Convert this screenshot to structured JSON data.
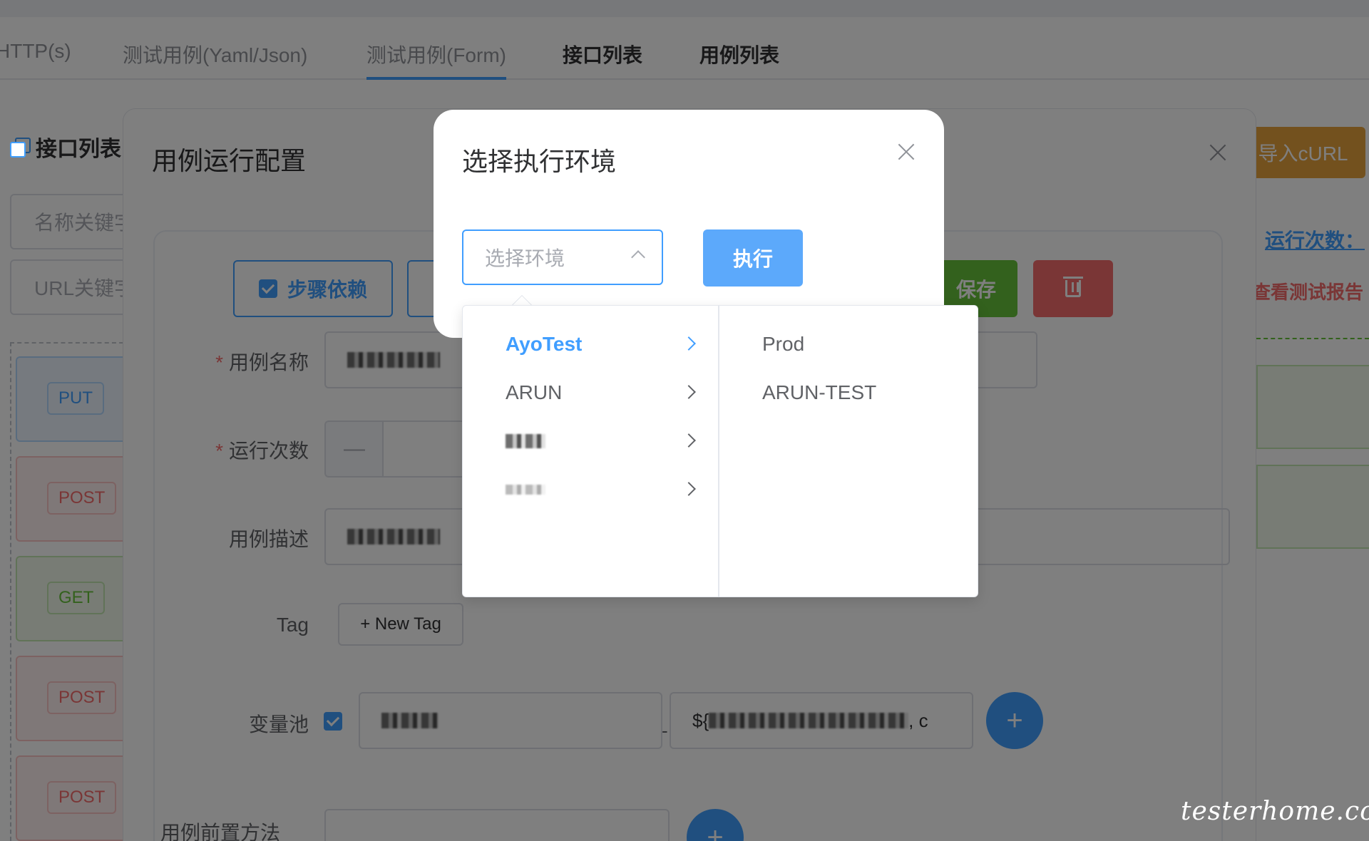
{
  "tabs": [
    {
      "label": "HTTP(s)"
    },
    {
      "label": "测试用例(Yaml/Json)"
    },
    {
      "label": "测试用例(Form)"
    },
    {
      "label": "接口列表"
    },
    {
      "label": "用例列表"
    }
  ],
  "sidebar": {
    "title": "接口列表",
    "name_placeholder": "名称关键字",
    "url_placeholder": "URL关键字",
    "methods": [
      "PUT",
      "POST",
      "GET",
      "POST",
      "POST"
    ]
  },
  "right_panel": {
    "import_label": "导入cURL",
    "run_count_link": "运行次数：",
    "view_report": "查看测试报告"
  },
  "config_dialog": {
    "title": "用例运行配置",
    "step_dependency_label": "步骤依赖",
    "save_label": "保存",
    "fields": {
      "case_name_label": "用例名称",
      "run_times_label": "运行次数",
      "case_desc_label": "用例描述",
      "tag_label": "Tag",
      "new_tag_label": "+ New Tag",
      "var_pool_label": "变量池",
      "var_value_text": "${",
      "var_value_tail": ", c",
      "pre_method_label": "用例前置方法",
      "stepper_minus": "—",
      "add_symbol": "+"
    }
  },
  "env_dialog": {
    "title": "选择执行环境",
    "select_placeholder": "选择环境",
    "execute_label": "执行",
    "level1": [
      {
        "label": "AyoTest",
        "active": true
      },
      {
        "label": "ARUN",
        "active": false
      },
      {
        "label": "",
        "active": false
      },
      {
        "label": "",
        "active": false
      }
    ],
    "level2": [
      {
        "label": "Prod"
      },
      {
        "label": "ARUN-TEST"
      }
    ]
  },
  "watermark": "testerhome.com",
  "colors": {
    "primary": "#409eff",
    "success": "#67c23a",
    "danger": "#f56c6c",
    "warning": "#e6a23c"
  }
}
